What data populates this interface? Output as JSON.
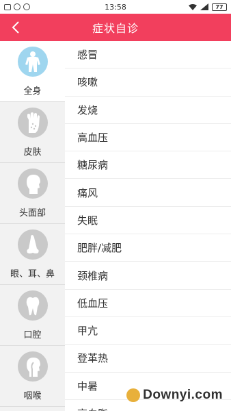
{
  "status_bar": {
    "time": "13:58",
    "battery": "77"
  },
  "header": {
    "title": "症状自诊"
  },
  "sidebar": {
    "items": [
      {
        "label": "全身",
        "icon": "full-body-icon",
        "active": true
      },
      {
        "label": "皮肤",
        "icon": "hand-skin-icon",
        "active": false
      },
      {
        "label": "头面部",
        "icon": "head-icon",
        "active": false
      },
      {
        "label": "眼、耳、鼻",
        "icon": "nose-icon",
        "active": false
      },
      {
        "label": "口腔",
        "icon": "tooth-icon",
        "active": false
      },
      {
        "label": "咽喉",
        "icon": "throat-icon",
        "active": false
      }
    ]
  },
  "symptoms": [
    "感冒",
    "咳嗽",
    "发烧",
    "高血压",
    "糖尿病",
    "痛风",
    "失眠",
    "肥胖/减肥",
    "颈椎病",
    "低血压",
    "甲亢",
    "登革热",
    "中暑",
    "高血脂"
  ],
  "watermark": {
    "text": "Downyi.com"
  },
  "colors": {
    "accent": "#f23f5d",
    "sidebar_bg": "#f2f2f2",
    "active_icon_bg": "#9fd6ef",
    "icon_bg": "#c9c9c9"
  }
}
